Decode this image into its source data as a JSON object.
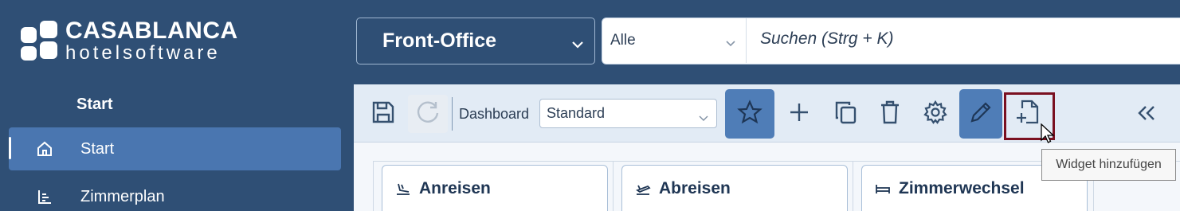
{
  "brand": {
    "line1": "CASABLANCA",
    "line2": "hotelsoftware"
  },
  "sidebar": {
    "section_title": "Start",
    "items": [
      {
        "label": "Start",
        "icon": "home-icon",
        "active": true
      },
      {
        "label": "Zimmerplan",
        "icon": "room-plan-icon",
        "active": false
      }
    ]
  },
  "topbar": {
    "module_select": {
      "value": "Front-Office"
    },
    "search": {
      "scope": "Alle",
      "placeholder": "Suchen (Strg + K)"
    }
  },
  "toolbar": {
    "dashboard_label": "Dashboard",
    "dashboard_select": "Standard",
    "buttons": [
      "save-icon",
      "refresh-icon",
      "star-icon",
      "plus-icon",
      "copy-icon",
      "trash-icon",
      "gear-icon",
      "pencil-icon",
      "add-widget-icon",
      "collapse-icon"
    ]
  },
  "tooltip": "Widget hinzufügen",
  "widgets": [
    {
      "title": "Anreisen",
      "icon": "arrival-icon"
    },
    {
      "title": "Abreisen",
      "icon": "departure-icon"
    },
    {
      "title": "Zimmerwechsel",
      "icon": "bed-icon"
    }
  ],
  "colors": {
    "sidebar": "#2f4f75",
    "active": "#4a76b0",
    "highlight": "#7a1020"
  }
}
